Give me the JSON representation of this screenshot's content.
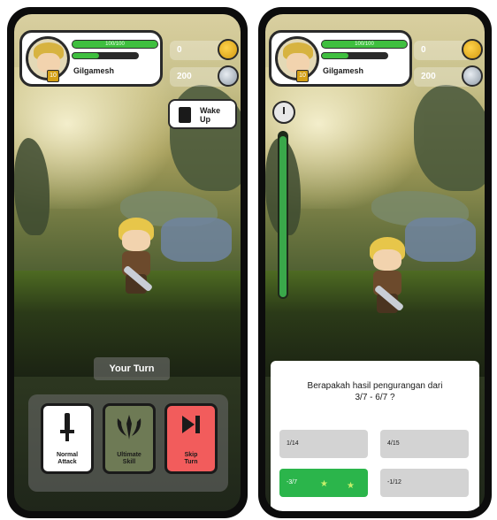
{
  "left": {
    "player": {
      "hp_text": "100/100",
      "name": "Gilgamesh",
      "level": "10"
    },
    "currencies": [
      {
        "value": "0",
        "icon": "gold-coin-icon"
      },
      {
        "value": "200",
        "icon": "silver-coin-icon"
      }
    ],
    "wake_button": {
      "line1": "Wake",
      "line2": "Up"
    },
    "turn_label": "Your Turn",
    "actions": [
      {
        "line1": "Normal",
        "line2": "Attack",
        "icon": "sword-icon",
        "color": "#ffffff"
      },
      {
        "line1": "Ultimate",
        "line2": "Skill",
        "icon": "ultimate-skill-icon",
        "color": "#6e7a55"
      },
      {
        "line1": "Skip",
        "line2": "Turn",
        "icon": "skip-icon",
        "color": "#f25c5c"
      }
    ]
  },
  "right": {
    "player": {
      "hp_text": "100/100",
      "name": "Gilgamesh",
      "level": "10"
    },
    "currencies": [
      {
        "value": "0",
        "icon": "gold-coin-icon"
      },
      {
        "value": "200",
        "icon": "silver-coin-icon"
      }
    ],
    "quiz": {
      "question_line1": "Berapakah hasil pengurangan dari",
      "question_line2": "3/7 - 6/7 ?",
      "options": [
        "1/14",
        "4/15",
        "-3/7",
        "-1/12"
      ],
      "correct_index": 2
    }
  }
}
